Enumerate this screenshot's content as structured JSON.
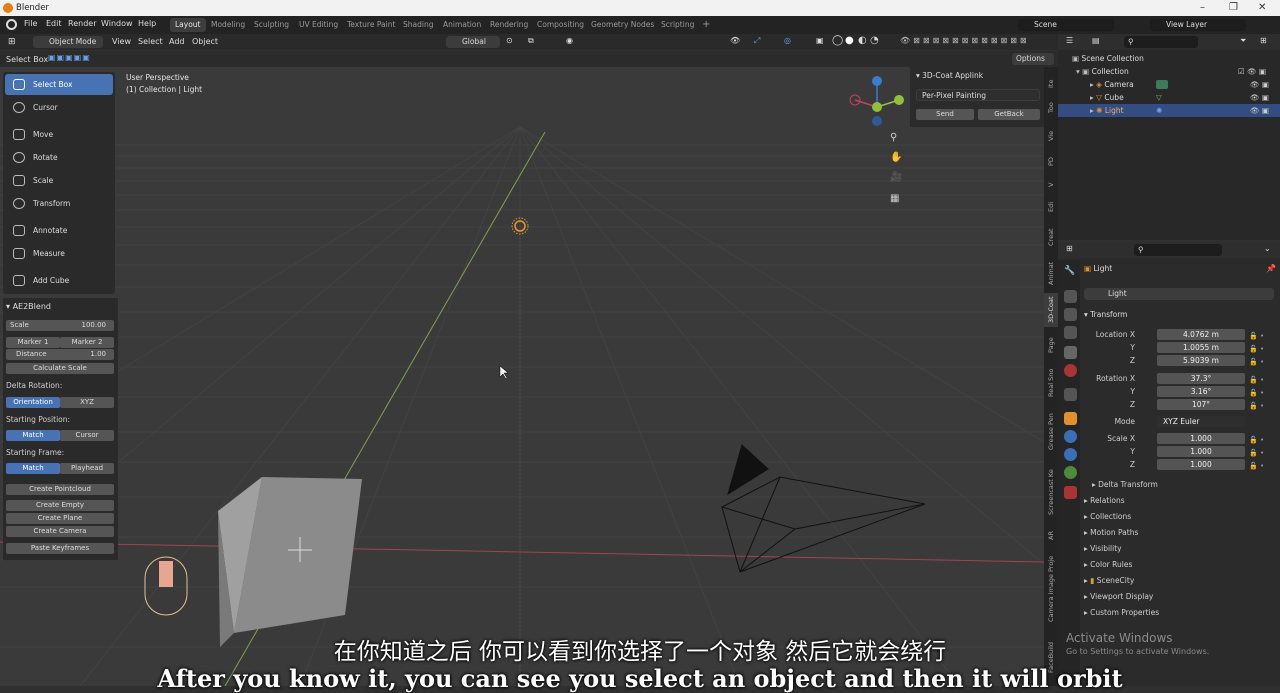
{
  "window": {
    "title": "Blender"
  },
  "menu": [
    "File",
    "Edit",
    "Render",
    "Window",
    "Help"
  ],
  "workspaces": [
    "Layout",
    "Modeling",
    "Sculpting",
    "UV Editing",
    "Texture Paint",
    "Shading",
    "Animation",
    "Rendering",
    "Compositing",
    "Geometry Nodes",
    "Scripting",
    "+"
  ],
  "scene": "Scene",
  "view_layer": "View Layer",
  "header": {
    "mode": "Object Mode",
    "view": "View",
    "select": "Select",
    "add": "Add",
    "object": "Object",
    "orientation": "Global",
    "select_box": "Select Box",
    "options": "Options"
  },
  "viewport": {
    "perspective": "User Perspective",
    "collection_line": "(1) Collection | Light"
  },
  "tools": [
    "Select Box",
    "Cursor",
    "Move",
    "Rotate",
    "Scale",
    "Transform",
    "Annotate",
    "Measure",
    "Add Cube"
  ],
  "ae2blend": {
    "title": "AE2Blend",
    "scale_label": "Scale",
    "scale_value": "100.00",
    "marker1": "Marker 1",
    "marker2": "Marker 2",
    "distance_label": "Distance",
    "distance_value": "1.00",
    "calc": "Calculate Scale",
    "delta_rotation": "Delta Rotation:",
    "orientation": "Orientation",
    "xyz": "XYZ",
    "starting_position": "Starting Position:",
    "match": "Match",
    "cursor": "Cursor",
    "starting_frame": "Starting Frame:",
    "playhead": "Playhead",
    "create_pointcloud": "Create Pointcloud",
    "create_empty": "Create Empty",
    "create_plane": "Create Plane",
    "create_camera": "Create Camera",
    "paste_keyframes": "Paste Keyframes"
  },
  "coat": {
    "title": "3D-Coat Applink",
    "mode": "Per-Pixel Painting",
    "send": "Send",
    "getback": "GetBack"
  },
  "sidetabs": [
    "Ite",
    "Too",
    "Vie",
    "PD",
    "V",
    "Edi",
    "Creat",
    "Animat",
    "3D-Coat",
    "Page",
    "Real Sno",
    "Grease Pen",
    "Screencast Ke",
    "AR",
    "Camera Image Proje",
    "FaceBuild"
  ],
  "outliner": {
    "scene_collection": "Scene Collection",
    "collection": "Collection",
    "items": [
      "Camera",
      "Cube",
      "Light"
    ]
  },
  "properties": {
    "object_name": "Light",
    "data_name": "Light",
    "transform": "Transform",
    "location_label": "Location X",
    "loc_x": "4.0762 m",
    "loc_y": "1.0055 m",
    "loc_z": "5.9039 m",
    "rotation_label": "Rotation X",
    "rot_x": "37.3°",
    "rot_y": "3.16°",
    "rot_z": "107°",
    "mode_label": "Mode",
    "mode_value": "XYZ Euler",
    "scale_label": "Scale X",
    "sc_x": "1.000",
    "sc_y": "1.000",
    "sc_z": "1.000",
    "y": "Y",
    "z": "Z",
    "delta": "Delta Transform",
    "sections": [
      "Relations",
      "Collections",
      "Motion Paths",
      "Visibility",
      "Color Rules",
      "SceneCity",
      "Viewport Display",
      "Custom Properties"
    ]
  },
  "activate": {
    "title": "Activate Windows",
    "sub": "Go to Settings to activate Windows."
  },
  "subtitles": {
    "zh": "在你知道之后 你可以看到你选择了一个对象 然后它就会绕行",
    "en": "After you know it, you can see you select an object and then it will orbit"
  }
}
